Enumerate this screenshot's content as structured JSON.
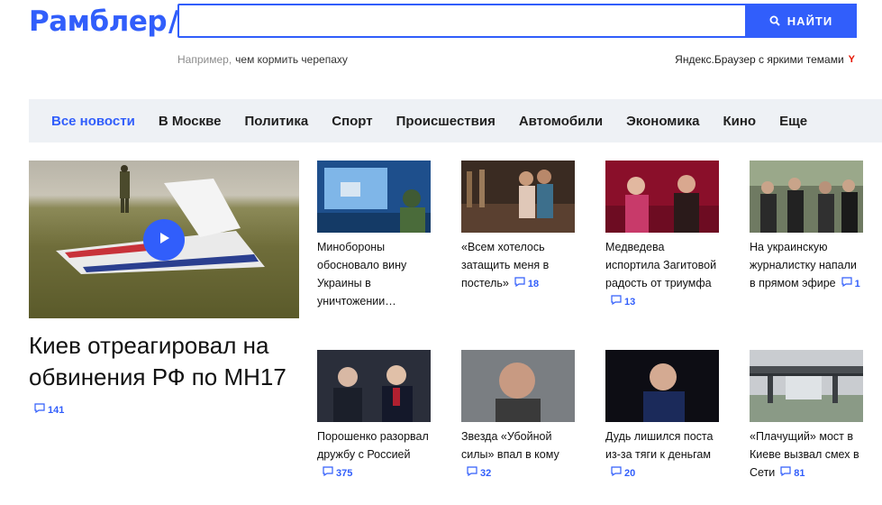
{
  "logo": {
    "text": "Рамблер",
    "slash": "/"
  },
  "search": {
    "value": "",
    "placeholder": "",
    "button_label": "НАЙТИ"
  },
  "hint": {
    "prefix": "Например,",
    "example": "чем кормить черепаху"
  },
  "promo": {
    "text": "Яндекс.Браузер с яркими темами",
    "icon": "Y"
  },
  "nav": [
    {
      "label": "Все новости",
      "active": true
    },
    {
      "label": "В Москве"
    },
    {
      "label": "Политика"
    },
    {
      "label": "Спорт"
    },
    {
      "label": "Происшествия"
    },
    {
      "label": "Автомобили"
    },
    {
      "label": "Экономика"
    },
    {
      "label": "Кино"
    },
    {
      "label": "Еще"
    }
  ],
  "featured": {
    "title": "Киев отреагировал на обвинения РФ по МН17",
    "comments": "141"
  },
  "cards": [
    {
      "title": "Минобороны обосновало вину Украины в уничтожении…",
      "comments": ""
    },
    {
      "title": "«Всем хотелось затащить меня в постель»",
      "comments": "18"
    },
    {
      "title": "Медведева испортила Загитовой радость от триумфа",
      "comments": "13"
    },
    {
      "title": "На украинскую журналистку напали в прямом эфире",
      "comments": "1"
    },
    {
      "title": "Порошенко разорвал дружбу с Россией",
      "comments": "375"
    },
    {
      "title": "Звезда «Убойной силы» впал в кому",
      "comments": "32"
    },
    {
      "title": "Дудь лишился поста из-за тяги к деньгам",
      "comments": "20"
    },
    {
      "title": "«Плачущий» мост в Киеве вызвал смех в Сети",
      "comments": "81"
    }
  ],
  "colors": {
    "accent": "#315efb",
    "nav_bg": "#eef1f5"
  }
}
